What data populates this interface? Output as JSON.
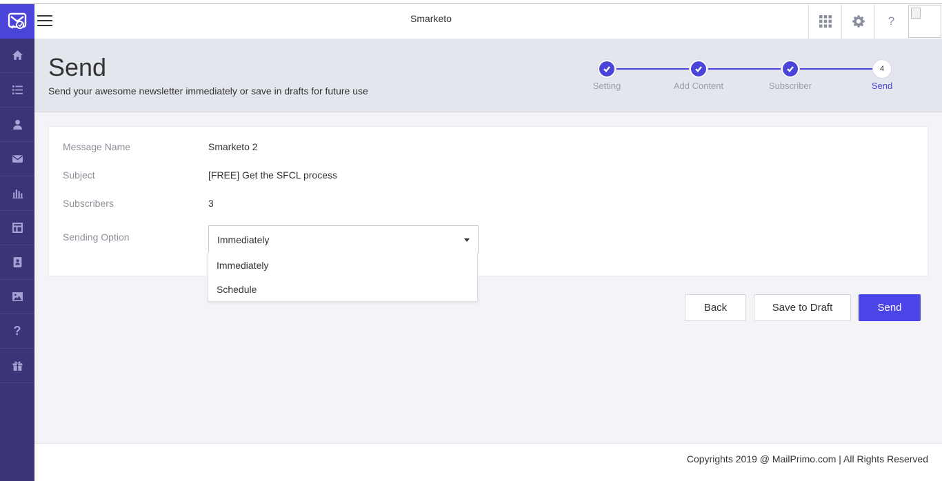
{
  "header": {
    "app_title": "Smarketo",
    "help_label": "?"
  },
  "sidebar": {
    "items": [
      {
        "icon": "home-icon"
      },
      {
        "icon": "list-icon"
      },
      {
        "icon": "user-icon"
      },
      {
        "icon": "mail-icon"
      },
      {
        "icon": "bar-chart-icon"
      },
      {
        "icon": "layout-icon"
      },
      {
        "icon": "contact-book-icon"
      },
      {
        "icon": "image-icon"
      },
      {
        "icon": "help-icon",
        "label": "?"
      },
      {
        "icon": "gift-icon"
      }
    ]
  },
  "page": {
    "title": "Send",
    "subtitle": "Send your awesome newsletter immediately or save in drafts for future use"
  },
  "stepper": {
    "steps": [
      {
        "label": "Setting",
        "status": "done"
      },
      {
        "label": "Add Content",
        "status": "done"
      },
      {
        "label": "Subscriber",
        "status": "done"
      },
      {
        "label": "Send",
        "status": "current",
        "number": "4"
      }
    ]
  },
  "details": {
    "message_name_label": "Message Name",
    "message_name_value": "Smarketo 2",
    "subject_label": "Subject",
    "subject_value": "[FREE] Get the SFCL process",
    "subscribers_label": "Subscribers",
    "subscribers_value": "3",
    "sending_option_label": "Sending Option",
    "sending_option_value": "Immediately",
    "sending_options": [
      "Immediately",
      "Schedule"
    ]
  },
  "actions": {
    "back": "Back",
    "save_draft": "Save to Draft",
    "send": "Send"
  },
  "footer": {
    "copyright": "Copyrights 2019 @  MailPrimo.com | All Rights Reserved"
  },
  "colors": {
    "accent": "#4b44e6",
    "sidebar": "#3b3577"
  }
}
